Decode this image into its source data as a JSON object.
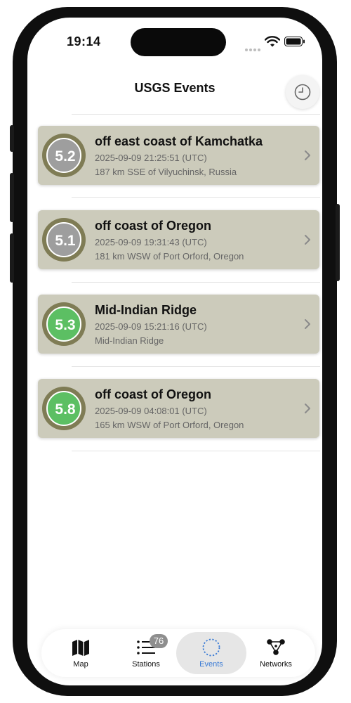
{
  "status_bar": {
    "time": "19:14"
  },
  "header": {
    "title": "USGS Events"
  },
  "events": [
    {
      "magnitude": "5.2",
      "title": "off east coast of Kamchatka",
      "time": "2025-09-09 21:25:51 (UTC)",
      "location": "187 km SSE of Vilyuchinsk, Russia",
      "color": "#9e9e9e"
    },
    {
      "magnitude": "5.1",
      "title": "off coast of Oregon",
      "time": "2025-09-09 19:31:43 (UTC)",
      "location": "181 km WSW of Port Orford, Oregon",
      "color": "#9e9e9e"
    },
    {
      "magnitude": "5.3",
      "title": "Mid-Indian Ridge",
      "time": "2025-09-09 15:21:16 (UTC)",
      "location": "Mid-Indian Ridge",
      "color": "#5cbf63"
    },
    {
      "magnitude": "5.8",
      "title": "off coast of Oregon",
      "time": "2025-09-09 04:08:01 (UTC)",
      "location": "165 km WSW of Port Orford, Oregon",
      "color": "#5cbf63"
    }
  ],
  "tabbar": {
    "tabs": [
      {
        "label": "Map",
        "icon": "map-icon"
      },
      {
        "label": "Stations",
        "icon": "list-icon",
        "badge": "76"
      },
      {
        "label": "Events",
        "icon": "events-icon"
      },
      {
        "label": "Networks",
        "icon": "network-icon"
      }
    ],
    "active_index": 2,
    "accent": "#3a7bd5"
  },
  "colors": {
    "card_bg": "#cccbbb",
    "ring": "#7f7c55"
  }
}
